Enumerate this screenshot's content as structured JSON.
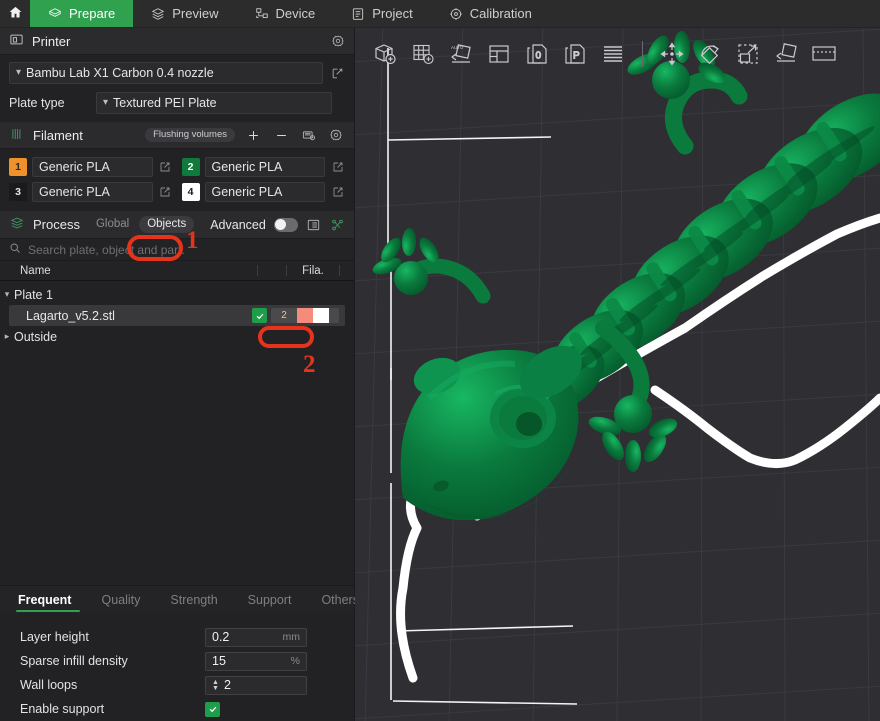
{
  "app": {
    "accent_green": "#2fa14f",
    "annotation_red": "#e8331c",
    "model_green": "#0a7a3d",
    "viewport_bg": "#2e2e33"
  },
  "topnav": {
    "home_icon": "home-icon",
    "items": [
      {
        "label": "Prepare",
        "icon": "prepare-icon",
        "active": true
      },
      {
        "label": "Preview",
        "icon": "preview-icon",
        "active": false
      },
      {
        "label": "Device",
        "icon": "device-icon",
        "active": false
      },
      {
        "label": "Project",
        "icon": "project-icon",
        "active": false
      },
      {
        "label": "Calibration",
        "icon": "calibration-icon",
        "active": false
      }
    ]
  },
  "printer": {
    "title": "Printer",
    "settings_icon": "gear-icon",
    "printer_icon": "printer-icon",
    "preset": "Bambu Lab X1 Carbon 0.4 nozzle",
    "plate_type_label": "Plate type",
    "plate_type": "Textured PEI Plate",
    "edit_icon": "edit-icon"
  },
  "filament": {
    "title": "Filament",
    "filament_icon": "filament-icon",
    "flushing_volumes_label": "Flushing volumes",
    "add_icon": "plus-icon",
    "remove_icon": "minus-icon",
    "ams_icon": "ams-icon",
    "settings_icon": "gear-icon",
    "slots": [
      {
        "index": "1",
        "name": "Generic PLA",
        "color": "#f0922b",
        "text_color": "#2a2a2a"
      },
      {
        "index": "2",
        "name": "Generic PLA",
        "color": "#0f7a3c",
        "text_color": "#ffffff"
      },
      {
        "index": "3",
        "name": "Generic PLA",
        "color": "#1a1a1a",
        "text_color": "#e6e6e6"
      },
      {
        "index": "4",
        "name": "Generic PLA",
        "color": "#ffffff",
        "text_color": "#1a1a1a"
      }
    ]
  },
  "process": {
    "title": "Process",
    "process_icon": "process-icon",
    "scope_global": "Global",
    "scope_objects": "Objects",
    "advanced_label": "Advanced",
    "advanced_on": false,
    "list_icon": "list-view-icon",
    "tree_icon": "object-tree-icon"
  },
  "search": {
    "icon": "search-icon",
    "placeholder": "Search plate, object and part."
  },
  "object_list": {
    "columns": {
      "name": "Name",
      "fila": "Fila."
    },
    "plate": {
      "label": "Plate 1",
      "expanded": true
    },
    "object": {
      "name": "Lagarto_v5.2.stl",
      "printable": true,
      "fila_index": "2",
      "fila_color": "#f48b7b",
      "fila_color_2": "#ffffff"
    },
    "outside": {
      "label": "Outside",
      "expanded": false
    }
  },
  "settings": {
    "tabs": [
      {
        "label": "Frequent",
        "active": true
      },
      {
        "label": "Quality",
        "active": false
      },
      {
        "label": "Strength",
        "active": false
      },
      {
        "label": "Support",
        "active": false
      },
      {
        "label": "Others",
        "active": false
      }
    ],
    "rows": [
      {
        "label": "Layer height",
        "value": "0.2",
        "unit": "mm",
        "type": "text"
      },
      {
        "label": "Sparse infill density",
        "value": "15",
        "unit": "%",
        "type": "text"
      },
      {
        "label": "Wall loops",
        "value": "2",
        "unit": "",
        "type": "spinner"
      },
      {
        "label": "Enable support",
        "value": "",
        "unit": "",
        "type": "checkbox",
        "checked": true
      }
    ]
  },
  "viewport_toolbar": {
    "items": [
      {
        "icon": "add-object-icon"
      },
      {
        "icon": "add-plate-icon"
      },
      {
        "icon": "auto-orient-icon"
      },
      {
        "icon": "arrange-icon"
      },
      {
        "icon": "copy-icon"
      },
      {
        "icon": "paste-icon"
      },
      {
        "icon": "layers-icon"
      },
      {
        "icon": "separator"
      },
      {
        "icon": "move-icon"
      },
      {
        "icon": "rotate-icon"
      },
      {
        "icon": "scale-icon"
      },
      {
        "icon": "place-on-face-icon"
      },
      {
        "icon": "cut-icon"
      }
    ]
  },
  "annotations": [
    {
      "id": "1",
      "label": "1",
      "target": "objects-scope-toggle"
    },
    {
      "id": "2",
      "label": "2",
      "target": "object-filament-chip"
    }
  ],
  "model": {
    "name": "Lagarto_v5.2.stl",
    "description": "articulated lizard 3D model, selected",
    "color": "#0a7a3d"
  }
}
